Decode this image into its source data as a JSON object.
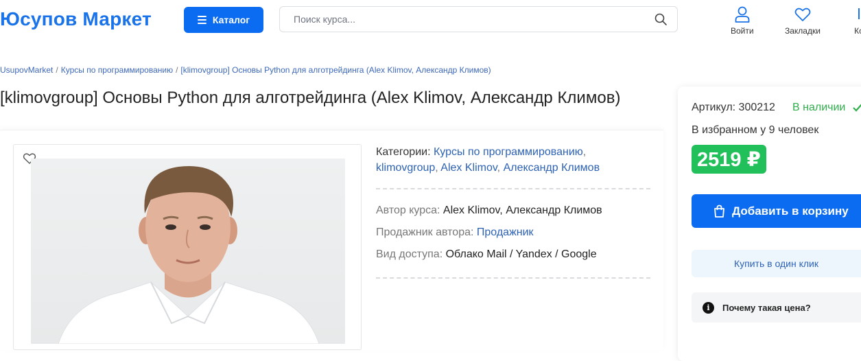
{
  "header": {
    "logo": "Юсупов Маркет",
    "catalog_label": "Каталог",
    "search_placeholder": "Поиск курса...",
    "icons": [
      {
        "name": "user-icon",
        "label": "Войти"
      },
      {
        "name": "heart-icon",
        "label": "Закладки"
      },
      {
        "name": "cart-icon",
        "label": "Ко"
      }
    ]
  },
  "breadcrumb": [
    "UsupovMarket",
    "Курсы по программированию",
    "[klimovgroup] Основы Python для алготрейдинга (Alex Klimov, Александр Климов)"
  ],
  "product": {
    "title": "[klimovgroup] Основы Python для алготрейдинга (Alex Klimov, Александр Климов)",
    "categories_label": "Категории:",
    "categories": [
      "Курсы по программированию",
      "klimovgroup",
      "Alex Klimov",
      "Александр Климов"
    ],
    "author_label": "Автор курса:",
    "author_value": "Alex Klimov, Александр Климов",
    "seller_label": "Продажник автора:",
    "seller_value": "Продажник",
    "access_label": "Вид доступа:",
    "access_value": "Облако Mail / Yandex / Google"
  },
  "sidebar": {
    "sku": "Артикул: 300212",
    "stock": "В наличии",
    "favorites": "В избранном у 9 человек",
    "price": "2519 ₽",
    "add_to_cart": "Добавить в корзину",
    "one_click": "Купить в один клик",
    "why_price": "Почему такая цена?"
  },
  "colors": {
    "brand": "#1a73e8",
    "button": "#0b6cf2",
    "price_bg": "#22c05a",
    "link": "#2d62b4",
    "in_stock": "#2fae4b"
  }
}
